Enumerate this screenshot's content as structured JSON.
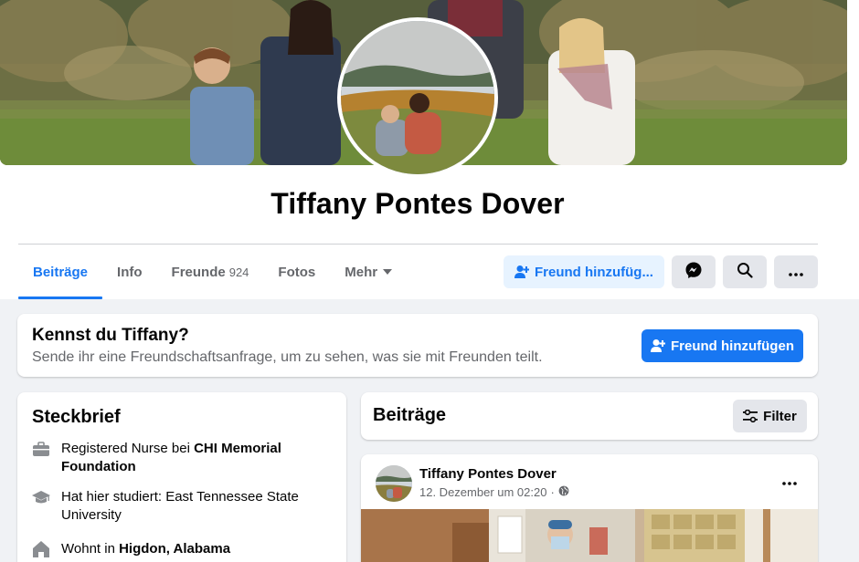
{
  "profile": {
    "name": "Tiffany Pontes Dover"
  },
  "tabs": [
    {
      "label": "Beiträge",
      "active": true
    },
    {
      "label": "Info"
    },
    {
      "label": "Freunde",
      "count": "924"
    },
    {
      "label": "Fotos"
    },
    {
      "label": "Mehr"
    }
  ],
  "actions": {
    "add_friend_label": "Freund hinzufüg...",
    "messenger_icon": "messenger-icon",
    "search_icon": "search-icon",
    "more_icon": "more-icon"
  },
  "know_card": {
    "title": "Kennst du Tiffany?",
    "subtitle": "Sende ihr eine Freundschaftsanfrage, um zu sehen, was sie mit Freunden teilt.",
    "button_label": "Freund hinzufügen"
  },
  "intro": {
    "title": "Steckbrief",
    "items": [
      {
        "icon": "briefcase-icon",
        "prefix": "Registered Nurse bei ",
        "bold": "CHI Memorial Foundation"
      },
      {
        "icon": "graduation-cap-icon",
        "prefix": "Hat hier studiert: East Tennessee State University",
        "bold": ""
      },
      {
        "icon": "home-icon",
        "prefix": "Wohnt in ",
        "bold": "Higdon, Alabama"
      }
    ]
  },
  "posts": {
    "title": "Beiträge",
    "filter_label": "Filter",
    "post": {
      "author": "Tiffany Pontes Dover",
      "date": "12. Dezember um 02:20",
      "separator": "·",
      "privacy_icon": "globe-icon"
    }
  },
  "colors": {
    "accent": "#1877f2",
    "background": "#f0f2f5",
    "secondary_text": "#65676b"
  }
}
